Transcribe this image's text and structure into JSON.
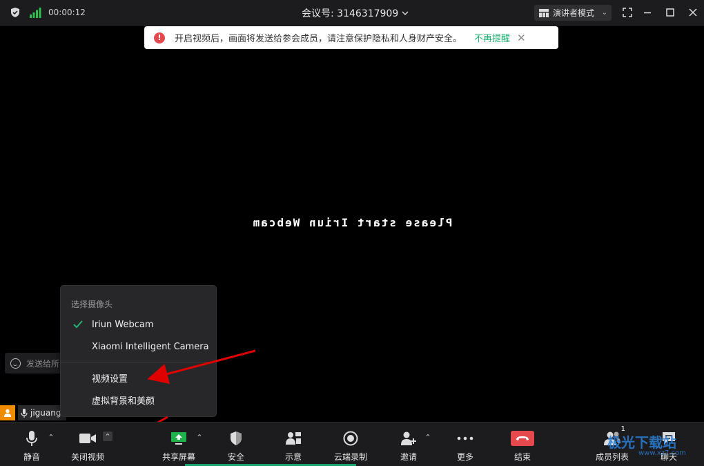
{
  "topbar": {
    "timer": "00:00:12",
    "meeting_label": "会议号: 3146317909",
    "presenter_mode": "演讲者模式"
  },
  "notice": {
    "message": "开启视频后，画面将发送给参会成员，请注意保护隐私和人身财产安全。",
    "dismiss": "不再提醒"
  },
  "video": {
    "message": "Please start Iriun Webcam"
  },
  "chat": {
    "placeholder": "发送给所"
  },
  "self_tile": {
    "name": "jiguang"
  },
  "camera_menu": {
    "header": "选择摄像头",
    "cameras": [
      {
        "label": "Iriun Webcam",
        "selected": true
      },
      {
        "label": "Xiaomi Intelligent Camera",
        "selected": false
      }
    ],
    "video_settings": "视频设置",
    "virtual_bg": "虚拟背景和美颜"
  },
  "toolbar": {
    "mute": "静音",
    "stop_video": "关闭视频",
    "share_screen": "共享屏幕",
    "security": "安全",
    "annotate": "示意",
    "cloud_record": "云端录制",
    "invite": "邀请",
    "more": "更多",
    "end": "结束",
    "members": "成员列表",
    "members_count": "1",
    "chat": "聊天"
  },
  "watermark": {
    "text": "极光下载站",
    "url": "www.xz7.com"
  },
  "colors": {
    "accent_green": "#22b573",
    "end_red": "#e5484d",
    "share_green": "#1fb24a",
    "annotation_red": "#e00000"
  }
}
